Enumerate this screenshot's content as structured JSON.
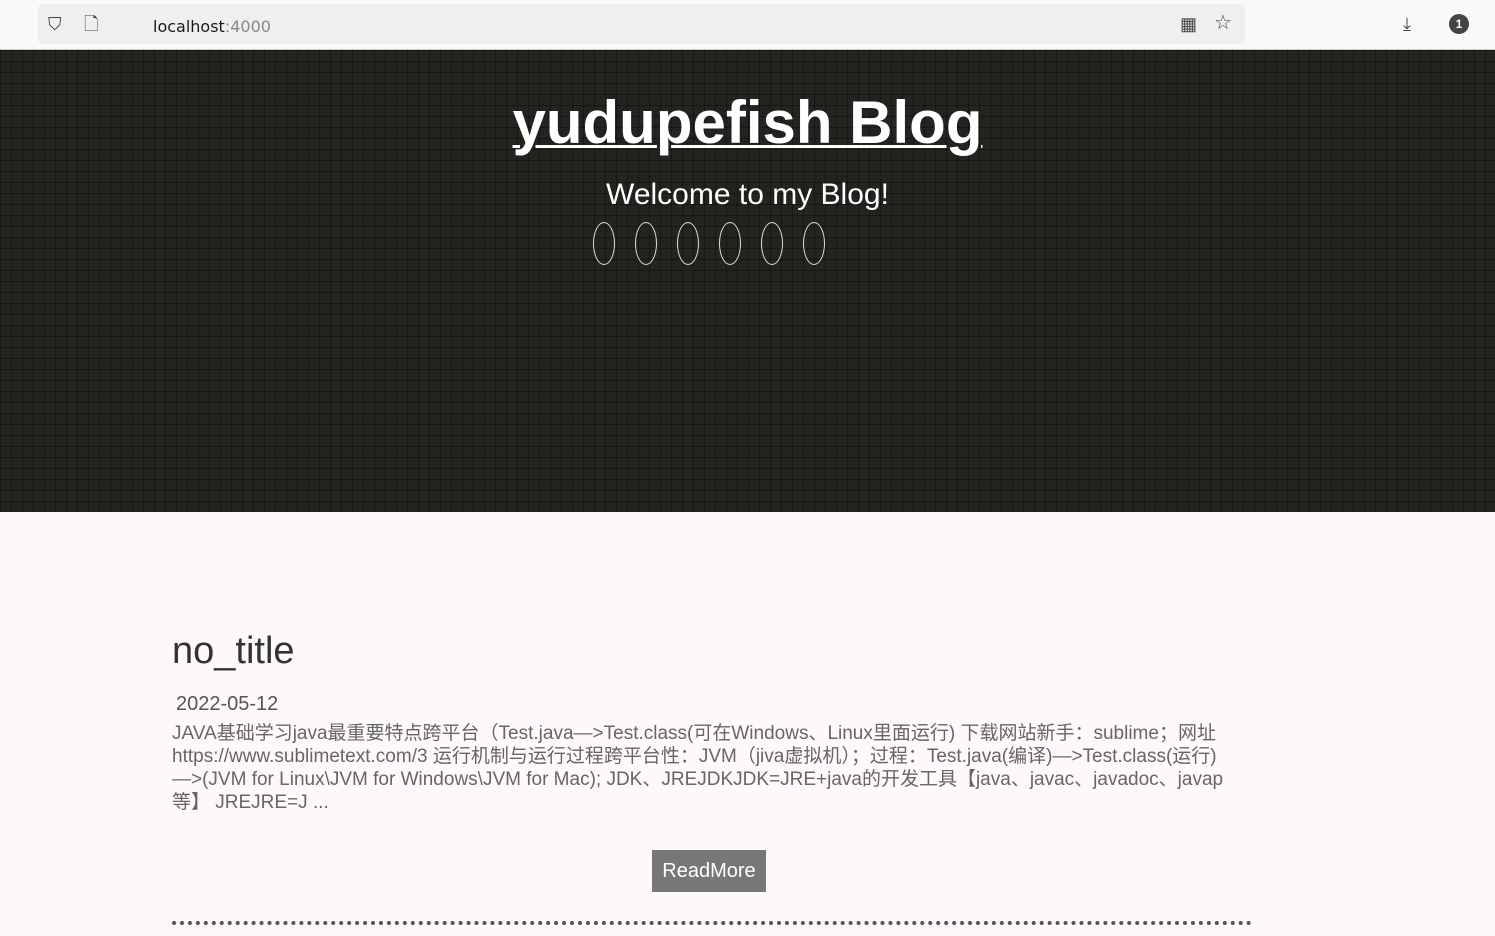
{
  "browser": {
    "url_host": "localhost",
    "url_port": ":4000",
    "badge": "1"
  },
  "header": {
    "title": "yudupefish Blog",
    "subtitle": "Welcome to my Blog!",
    "social_icons": [
      "icon-1",
      "icon-2",
      "icon-3",
      "icon-4",
      "icon-5",
      "icon-6"
    ]
  },
  "post": {
    "title": "no_title",
    "date": "2022-05-12",
    "excerpt": "JAVA基础学习java最重要特点跨平台（Test.java—>Test.class(可在Windows、Linux里面运行) 下载网站新手：sublime；网址https://www.sublimetext.com/3 运行机制与运行过程跨平台性：JVM（jiva虚拟机）；过程：Test.java(编译)—>Test.class(运行)—>(JVM for Linux\\JVM for Windows\\JVM for Mac); JDK、JREJDKJDK=JRE+java的开发工具【java、javac、javadoc、javap等】 JREJRE=J ...",
    "readmore": "ReadMore"
  }
}
